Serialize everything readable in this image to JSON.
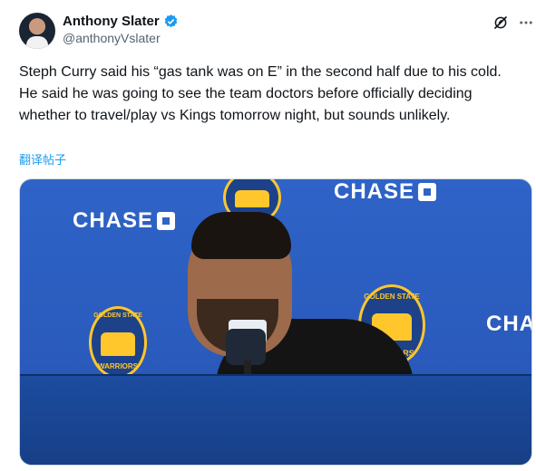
{
  "author": {
    "display_name": "Anthony Slater",
    "handle": "@anthonyVslater",
    "verified": true
  },
  "icons": {
    "verified": "verified-badge-icon",
    "grok": "grok-icon",
    "more": "more-options-icon"
  },
  "tweet": {
    "text": "Steph Curry said his “gas tank was on E” in the second half due to his cold. He said he was going to see the team doctors before officially deciding whether to travel/play vs Kings tomorrow night, but sounds unlikely.",
    "translate_label": "翻译帖子"
  },
  "media": {
    "sponsor_text": "CHASE",
    "sponsor_text_partial": "CHA",
    "team_logo_top": "GOLDEN STATE",
    "team_logo_bottom": "WARRIORS"
  },
  "colors": {
    "accent": "#1d9bf0",
    "backdrop_blue": "#2f63c7",
    "warriors_gold": "#ffc72c",
    "warriors_blue": "#1d428a"
  }
}
